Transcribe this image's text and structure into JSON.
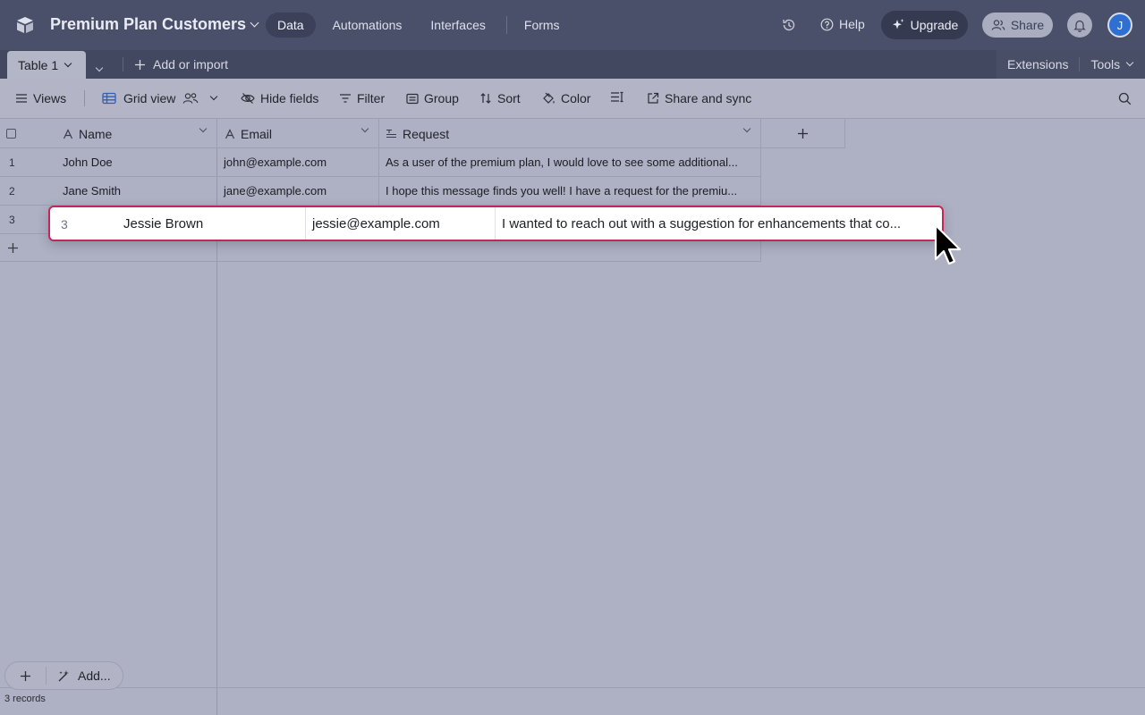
{
  "topbar": {
    "base_title": "Premium Plan Customers",
    "nav": [
      "Data",
      "Automations",
      "Interfaces",
      "Forms"
    ],
    "active_nav": "Data",
    "help_label": "Help",
    "upgrade_label": "Upgrade",
    "share_label": "Share",
    "avatar_initial": "J"
  },
  "tabbar": {
    "active_table": "Table 1",
    "add_import_label": "Add or import",
    "extensions_label": "Extensions",
    "tools_label": "Tools"
  },
  "viewbar": {
    "views_label": "Views",
    "view_name": "Grid view",
    "hide_fields_label": "Hide fields",
    "filter_label": "Filter",
    "group_label": "Group",
    "sort_label": "Sort",
    "color_label": "Color",
    "share_sync_label": "Share and sync"
  },
  "grid": {
    "columns": [
      {
        "name": "Name",
        "type": "text"
      },
      {
        "name": "Email",
        "type": "text"
      },
      {
        "name": "Request",
        "type": "long-text"
      }
    ],
    "rows": [
      {
        "num": "1",
        "name": "John Doe",
        "email": "john@example.com",
        "request": "As a user of the premium plan, I would love to see some additional..."
      },
      {
        "num": "2",
        "name": "Jane Smith",
        "email": "jane@example.com",
        "request": "I hope this message finds you well! I have a request for the premiu..."
      },
      {
        "num": "3",
        "name": "Jessie Brown",
        "email": "jessie@example.com",
        "request": "I wanted to reach out with a suggestion for enhancements that co..."
      }
    ]
  },
  "footer": {
    "add_label": "Add...",
    "record_count": "3 records"
  },
  "colors": {
    "topbar": "#4a5069",
    "tabbar": "#42485f",
    "canvas": "#aeb0c3",
    "drag_border": "#c5265a",
    "avatar": "#2f6fd1"
  },
  "icons": [
    "base-logo-icon",
    "history-icon",
    "help-icon",
    "upgrade-sparkle-icon",
    "share-people-icon",
    "bell-icon",
    "plus-icon",
    "menu-icon",
    "grid-view-icon",
    "collaborators-icon",
    "hide-fields-icon",
    "filter-icon",
    "group-icon",
    "sort-icon",
    "color-icon",
    "row-height-icon",
    "share-sync-icon",
    "search-icon",
    "text-field-icon",
    "long-text-field-icon",
    "cursor-icon",
    "magic-add-icon"
  ]
}
